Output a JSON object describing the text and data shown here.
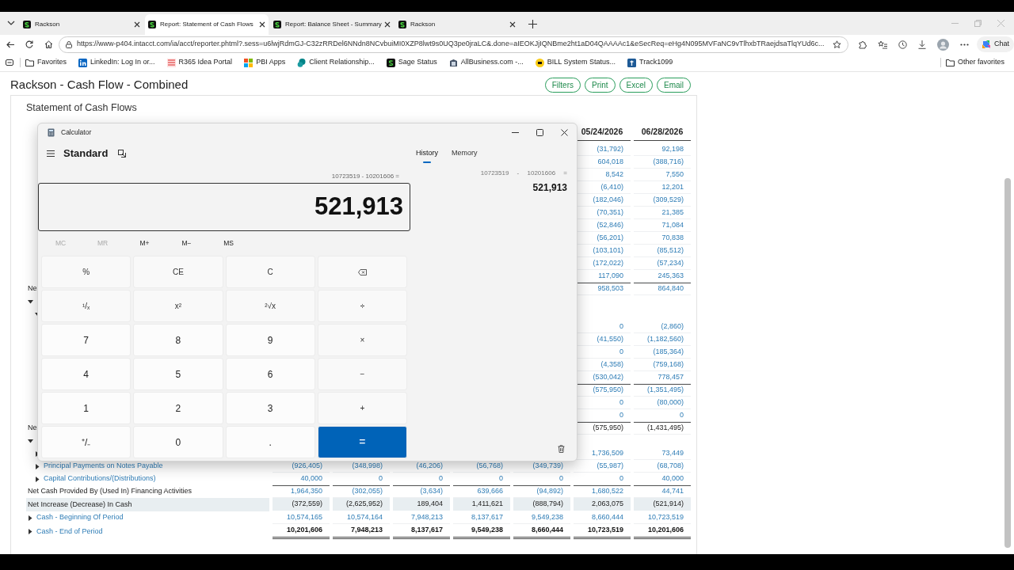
{
  "browser": {
    "tabs": [
      {
        "title": "Rackson",
        "selected": false
      },
      {
        "title": "Report: Statement of Cash Flows",
        "selected": true
      },
      {
        "title": "Report: Balance Sheet - Summary",
        "selected": false
      },
      {
        "title": "Rackson",
        "selected": false
      }
    ],
    "url": "https://www-p404.intacct.com/ia/acct/reporter.phtml?.sess=u6lwjRdmGJ-C32zRRDel6NNdn8NCvbuiMI0XZP8lwt9s0UQ3pe0jraLC&.done=aIEOKJjIQNBme2ht1aD04QAAAAc1&eSecReq=eHg4N095MVFaNC9vTlhxbTRaejdsaTlqYUd6c...",
    "bookmarks": [
      {
        "label": "Favorites",
        "kind": "folder"
      },
      {
        "label": "LinkedIn: Log In or...",
        "kind": "linkedin"
      },
      {
        "label": "R365 Idea Portal",
        "kind": "r365"
      },
      {
        "label": "PBI Apps",
        "kind": "grid"
      },
      {
        "label": "Client Relationship...",
        "kind": "sharepoint"
      },
      {
        "label": "Sage Status",
        "kind": "sage"
      },
      {
        "label": "AllBusiness.com -...",
        "kind": "building"
      },
      {
        "label": "BILL System Status...",
        "kind": "bill"
      },
      {
        "label": "Track1099",
        "kind": "track"
      }
    ],
    "other_favorites": "Other favorites",
    "chat": "Chat"
  },
  "report": {
    "title": "Rackson - Cash Flow - Combined",
    "actions": [
      "Filters",
      "Print",
      "Excel",
      "Email"
    ],
    "subtitle": "Statement of Cash Flows",
    "columns": [
      "05/24/2026",
      "06/28/2026"
    ],
    "rows": [
      {
        "kind": "detail",
        "values": [
          "(31,792)",
          "92,198"
        ]
      },
      {
        "kind": "detail",
        "values": [
          "604,018",
          "(388,716)"
        ]
      },
      {
        "kind": "detail",
        "values": [
          "8,542",
          "7,550"
        ]
      },
      {
        "kind": "detail",
        "values": [
          "(6,410)",
          "12,201"
        ]
      },
      {
        "kind": "detail",
        "values": [
          "(182,046)",
          "(309,529)"
        ]
      },
      {
        "kind": "detail",
        "values": [
          "(70,351)",
          "21,385"
        ]
      },
      {
        "kind": "detail",
        "values": [
          "(52,846)",
          "71,084"
        ]
      },
      {
        "kind": "detail",
        "values": [
          "(56,201)",
          "70,838"
        ]
      },
      {
        "kind": "detail",
        "values": [
          "(103,101)",
          "(85,512)"
        ]
      },
      {
        "kind": "detail",
        "values": [
          "(172,022)",
          "(57,234)"
        ]
      },
      {
        "kind": "detail",
        "values": [
          "117,090",
          "245,363"
        ]
      },
      {
        "kind": "subtotal",
        "label": "Ne",
        "values": [
          "958,503",
          "864,840"
        ]
      },
      {
        "kind": "section",
        "expanded": true,
        "children": [
          {
            "kind": "section",
            "expanded": true,
            "children": [
              {
                "kind": "detail",
                "values": [
                  "0",
                  "(2,860)"
                ]
              },
              {
                "kind": "detail",
                "values": [
                  "(41,550)",
                  "(1,182,560)"
                ]
              },
              {
                "kind": "detail",
                "values": [
                  "0",
                  "(185,364)"
                ]
              },
              {
                "kind": "detail",
                "values": [
                  "(4,358)",
                  "(759,168)"
                ]
              },
              {
                "kind": "detail",
                "values": [
                  "(530,042)",
                  "778,457"
                ]
              }
            ]
          },
          {
            "kind": "subtotal",
            "values": [
              "(575,950)",
              "(1,351,495)"
            ]
          },
          {
            "kind": "detail",
            "values": [
              "0",
              "(80,000)"
            ]
          },
          {
            "kind": "detail",
            "values": [
              "0",
              "0"
            ]
          }
        ]
      },
      {
        "kind": "total",
        "label": "Ne",
        "values": [
          "(575,950)",
          "(1,431,495)"
        ]
      },
      {
        "kind": "section",
        "expanded": true,
        "children": [
          {
            "kind": "detail",
            "expanded": false,
            "values": [
              "1,736,509",
              "73,449"
            ]
          },
          {
            "kind": "detail",
            "label": "Principal Payments on Notes Payable",
            "expanded": false,
            "values": [
              "(926,405)",
              "(348,998)",
              "(46,206)",
              "(56,768)",
              "(349,739)",
              "(55,987)",
              "(68,708)"
            ]
          },
          {
            "kind": "detail",
            "label": "Capital Contributions/(Distributions)",
            "expanded": false,
            "values": [
              "40,000",
              "0",
              "0",
              "0",
              "0",
              "0",
              "40,000"
            ]
          }
        ]
      },
      {
        "kind": "subtotal",
        "label": "Net Cash Provided By (Used In) Financing Activities",
        "values": [
          "1,964,350",
          "(302,055)",
          "(3,634)",
          "639,666",
          "(94,892)",
          "1,680,522",
          "44,741"
        ]
      },
      {
        "kind": "highlight",
        "label": "Net Increase (Decrease) In Cash",
        "values": [
          "(372,559)",
          "(2,625,952)",
          "189,404",
          "1,411,621",
          "(888,794)",
          "2,063,075",
          "(521,914)"
        ]
      },
      {
        "kind": "detail",
        "label": "Cash - Beginning Of Period",
        "expanded": false,
        "values": [
          "10,574,165",
          "10,574,164",
          "7,948,213",
          "8,137,617",
          "9,549,238",
          "8,660,444",
          "10,723,519"
        ]
      },
      {
        "kind": "grand",
        "label": "Cash - End of Period",
        "expanded": false,
        "values": [
          "10,201,606",
          "7,948,213",
          "8,137,617",
          "9,549,238",
          "8,660,444",
          "10,723,519",
          "10,201,606"
        ]
      }
    ]
  },
  "calculator": {
    "title": "Calculator",
    "mode": "Standard",
    "tabs": [
      {
        "label": "History",
        "selected": true
      },
      {
        "label": "Memory",
        "selected": false
      }
    ],
    "expression": "10723519 - 10201606 =",
    "display": "521,913",
    "memory": [
      {
        "label": "MC",
        "disabled": true
      },
      {
        "label": "MR",
        "disabled": true
      },
      {
        "label": "M+",
        "disabled": false
      },
      {
        "label": "M−",
        "disabled": false
      },
      {
        "label": "MS",
        "disabled": false
      }
    ],
    "keys": [
      {
        "label": "%",
        "kind": "function"
      },
      {
        "label": "CE",
        "kind": "function"
      },
      {
        "label": "C",
        "kind": "function"
      },
      {
        "kind": "backspace"
      },
      {
        "label": "¹/ₓ",
        "kind": "function"
      },
      {
        "label": "x²",
        "kind": "function"
      },
      {
        "label": "²√x",
        "kind": "function"
      },
      {
        "label": "÷",
        "kind": "function"
      },
      {
        "label": "7",
        "kind": "digit"
      },
      {
        "label": "8",
        "kind": "digit"
      },
      {
        "label": "9",
        "kind": "digit"
      },
      {
        "label": "×",
        "kind": "function"
      },
      {
        "label": "4",
        "kind": "digit"
      },
      {
        "label": "5",
        "kind": "digit"
      },
      {
        "label": "6",
        "kind": "digit"
      },
      {
        "label": "−",
        "kind": "function"
      },
      {
        "label": "1",
        "kind": "digit"
      },
      {
        "label": "2",
        "kind": "digit"
      },
      {
        "label": "3",
        "kind": "digit"
      },
      {
        "label": "+",
        "kind": "function"
      },
      {
        "label": "⁺/₋",
        "kind": "digit"
      },
      {
        "label": "0",
        "kind": "digit"
      },
      {
        "label": ".",
        "kind": "digit"
      },
      {
        "label": "=",
        "kind": "equals"
      }
    ],
    "history": [
      {
        "expression": "10723519 - 10201606 =",
        "result": "521,913"
      }
    ]
  }
}
